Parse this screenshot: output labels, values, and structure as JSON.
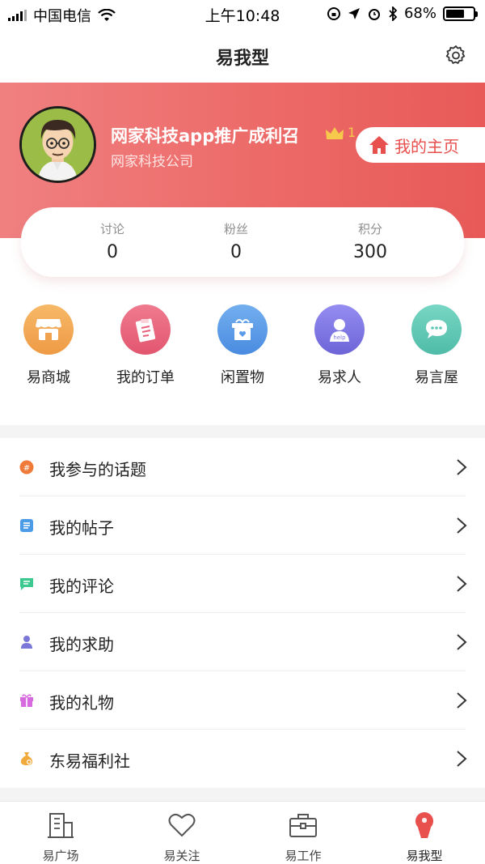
{
  "status_bar": {
    "carrier": "中国电信",
    "time": "上午10:48",
    "battery_percent": "68%",
    "battery_level": 0.68
  },
  "nav": {
    "title": "易我型",
    "settings_icon": "gear-icon"
  },
  "profile": {
    "name": "网家科技app推广成利召",
    "company": "网家科技公司",
    "level_badge": "1",
    "home_button_label": "我的主页",
    "accent_color": "#e8504e"
  },
  "stats": [
    {
      "label": "讨论",
      "value": "0"
    },
    {
      "label": "粉丝",
      "value": "0"
    },
    {
      "label": "积分",
      "value": "300"
    }
  ],
  "quick_actions": [
    {
      "label": "易商城",
      "icon": "shop-icon",
      "color": "#f0a24f"
    },
    {
      "label": "我的订单",
      "icon": "order-icon",
      "color": "#e8607a"
    },
    {
      "label": "闲置物",
      "icon": "box-icon",
      "color": "#5a9be8"
    },
    {
      "label": "易求人",
      "icon": "help-person-icon",
      "color": "#7d74e0"
    },
    {
      "label": "易言屋",
      "icon": "chat-bubble-icon",
      "color": "#5ec7b3"
    }
  ],
  "menu": [
    {
      "label": "我参与的话题",
      "icon": "topic-icon",
      "color": "#f07a3a"
    },
    {
      "label": "我的帖子",
      "icon": "post-icon",
      "color": "#4b9be6"
    },
    {
      "label": "我的评论",
      "icon": "comment-icon",
      "color": "#3cc98f"
    },
    {
      "label": "我的求助",
      "icon": "help-icon",
      "color": "#7a77d8"
    },
    {
      "label": "我的礼物",
      "icon": "gift-icon",
      "color": "#d86ae0"
    },
    {
      "label": "东易福利社",
      "icon": "money-bag-icon",
      "color": "#f2a93b"
    }
  ],
  "tabs": [
    {
      "label": "易广场",
      "icon": "building-icon",
      "active": false
    },
    {
      "label": "易关注",
      "icon": "heart-icon",
      "active": false
    },
    {
      "label": "易工作",
      "icon": "briefcase-icon",
      "active": false
    },
    {
      "label": "易我型",
      "icon": "profile-icon",
      "active": true
    }
  ]
}
